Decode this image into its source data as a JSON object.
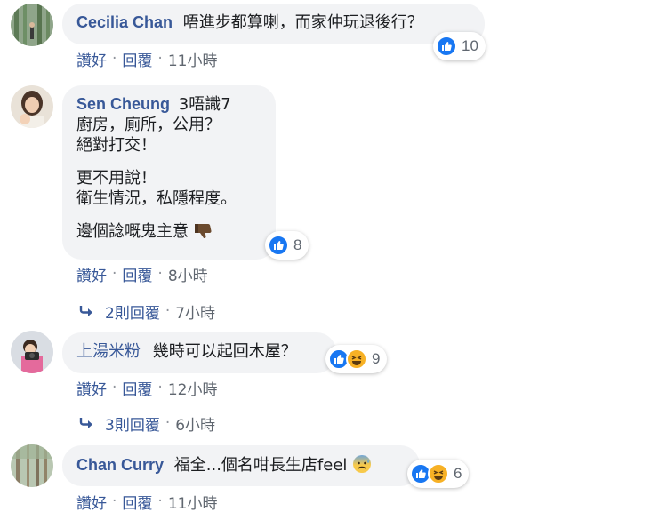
{
  "comments": [
    {
      "name": "Cecilia Chan",
      "text": "唔進步都算喇，而家仲玩退後行？",
      "reaction_count": "10",
      "actions": {
        "like": "讚好",
        "reply": "回覆",
        "time": "11小時"
      }
    },
    {
      "name": "Sen Cheung",
      "badge": "3唔識7",
      "lines": [
        "廚房，廁所，公用？",
        "絕對打交！",
        "更不用說！",
        "衛生情況，私隱程度。",
        "邊個諗嘅鬼主意"
      ],
      "reaction_count": "8",
      "actions": {
        "like": "讚好",
        "reply": "回覆",
        "time": "8小時"
      },
      "replies": {
        "label": "2則回覆",
        "time": "7小時"
      }
    },
    {
      "name": "上湯米粉",
      "text": "幾時可以起回木屋？",
      "reaction_count": "9",
      "actions": {
        "like": "讚好",
        "reply": "回覆",
        "time": "12小時"
      },
      "replies": {
        "label": "3則回覆",
        "time": "6小時"
      }
    },
    {
      "name": "Chan Curry",
      "text": "福全...個名咁長生店feel",
      "reaction_count": "6",
      "actions": {
        "like": "讚好",
        "reply": "回覆",
        "time": "11小時"
      }
    }
  ],
  "separator": "·",
  "colors": {
    "name": "#385898",
    "bubble": "#f2f3f5",
    "like": "#1877f2",
    "haha": "#f7b125",
    "meta": "#606770"
  }
}
